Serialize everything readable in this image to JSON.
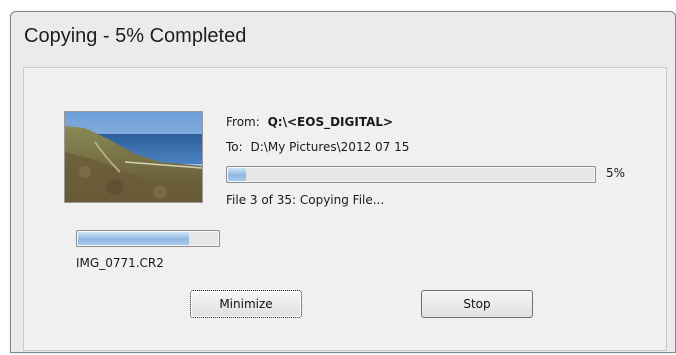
{
  "window": {
    "title": "Copying - 5% Completed"
  },
  "copy": {
    "from_label": "From:",
    "from_value": "Q:\\<EOS_DIGITAL>",
    "to_label": "To:",
    "to_value": "D:\\My Pictures\\2012 07 15",
    "overall_progress": 0.05,
    "percent_text": "5%",
    "status": "File 3 of 35: Copying File..."
  },
  "current_file": {
    "name": "IMG_0771.CR2",
    "progress": 0.78
  },
  "buttons": {
    "minimize": "Minimize",
    "stop": "Stop"
  },
  "colors": {
    "progress_fill": "#8fb8e4",
    "window_bg": "#ebebeb"
  }
}
